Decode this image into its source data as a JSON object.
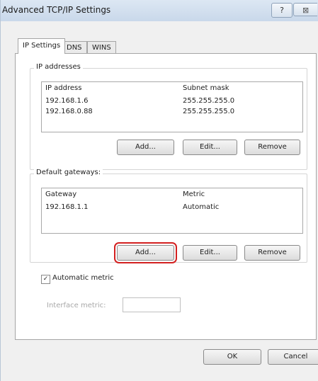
{
  "window": {
    "title": "Advanced TCP/IP Settings",
    "help_label": "?",
    "close_label": "⊠"
  },
  "tabs": [
    {
      "label": "IP Settings",
      "active": true
    },
    {
      "label": "DNS",
      "active": false
    },
    {
      "label": "WINS",
      "active": false
    }
  ],
  "ip_addresses": {
    "group_label": "IP addresses",
    "headers": [
      "IP address",
      "Subnet mask"
    ],
    "rows": [
      {
        "address": "192.168.1.6",
        "mask": "255.255.255.0"
      },
      {
        "address": "192.168.0.88",
        "mask": "255.255.255.0"
      }
    ],
    "buttons": {
      "add": "Add...",
      "edit": "Edit...",
      "remove": "Remove"
    }
  },
  "default_gateways": {
    "group_label": "Default gateways:",
    "headers": [
      "Gateway",
      "Metric"
    ],
    "rows": [
      {
        "gateway": "192.168.1.1",
        "metric": "Automatic"
      }
    ],
    "buttons": {
      "add": "Add...",
      "edit": "Edit...",
      "remove": "Remove"
    }
  },
  "metric": {
    "checkbox_label": "Automatic metric",
    "checked": true,
    "interface_label": "Interface metric:",
    "interface_value": ""
  },
  "footer": {
    "ok": "OK",
    "cancel": "Cancel"
  },
  "colors": {
    "highlight": "#d32020",
    "titlebar": "#c9d8ea"
  }
}
